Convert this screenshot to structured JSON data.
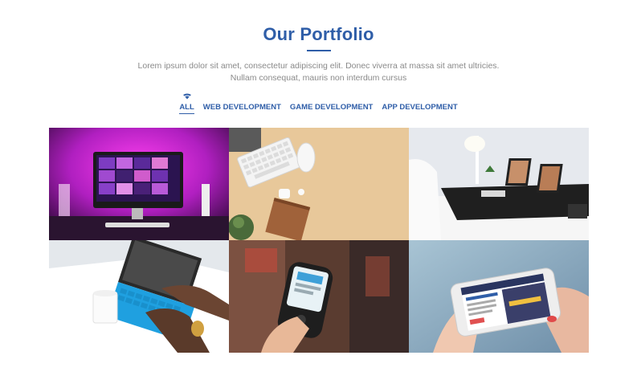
{
  "section": {
    "title": "Our Portfolio",
    "intro_line1": "Lorem ipsum dolor sit amet, consectetur adipiscing elit. Donec viverra at massa sit amet ultricies.",
    "intro_line2": "Nullam consequat, mauris non interdum cursus"
  },
  "filters": [
    {
      "label": "ALL",
      "active": true
    },
    {
      "label": "WEB DEVELOPMENT",
      "active": false
    },
    {
      "label": "GAME DEVELOPMENT",
      "active": false
    },
    {
      "label": "APP DEVELOPMENT",
      "active": false
    }
  ],
  "colors": {
    "accent": "#2f5ea8",
    "muted_text": "#8a8a8a"
  },
  "portfolio_items": [
    {
      "subject": "desktop computer with pink and purple lighting"
    },
    {
      "subject": "keyboard, mouse and notebook on beige desk"
    },
    {
      "subject": "white desk with two laptops and lamp"
    },
    {
      "subject": "hands typing on tablet keyboard with coffee cup"
    },
    {
      "subject": "hand holding rugged handheld device"
    },
    {
      "subject": "hands holding smartphone in landscape"
    }
  ]
}
